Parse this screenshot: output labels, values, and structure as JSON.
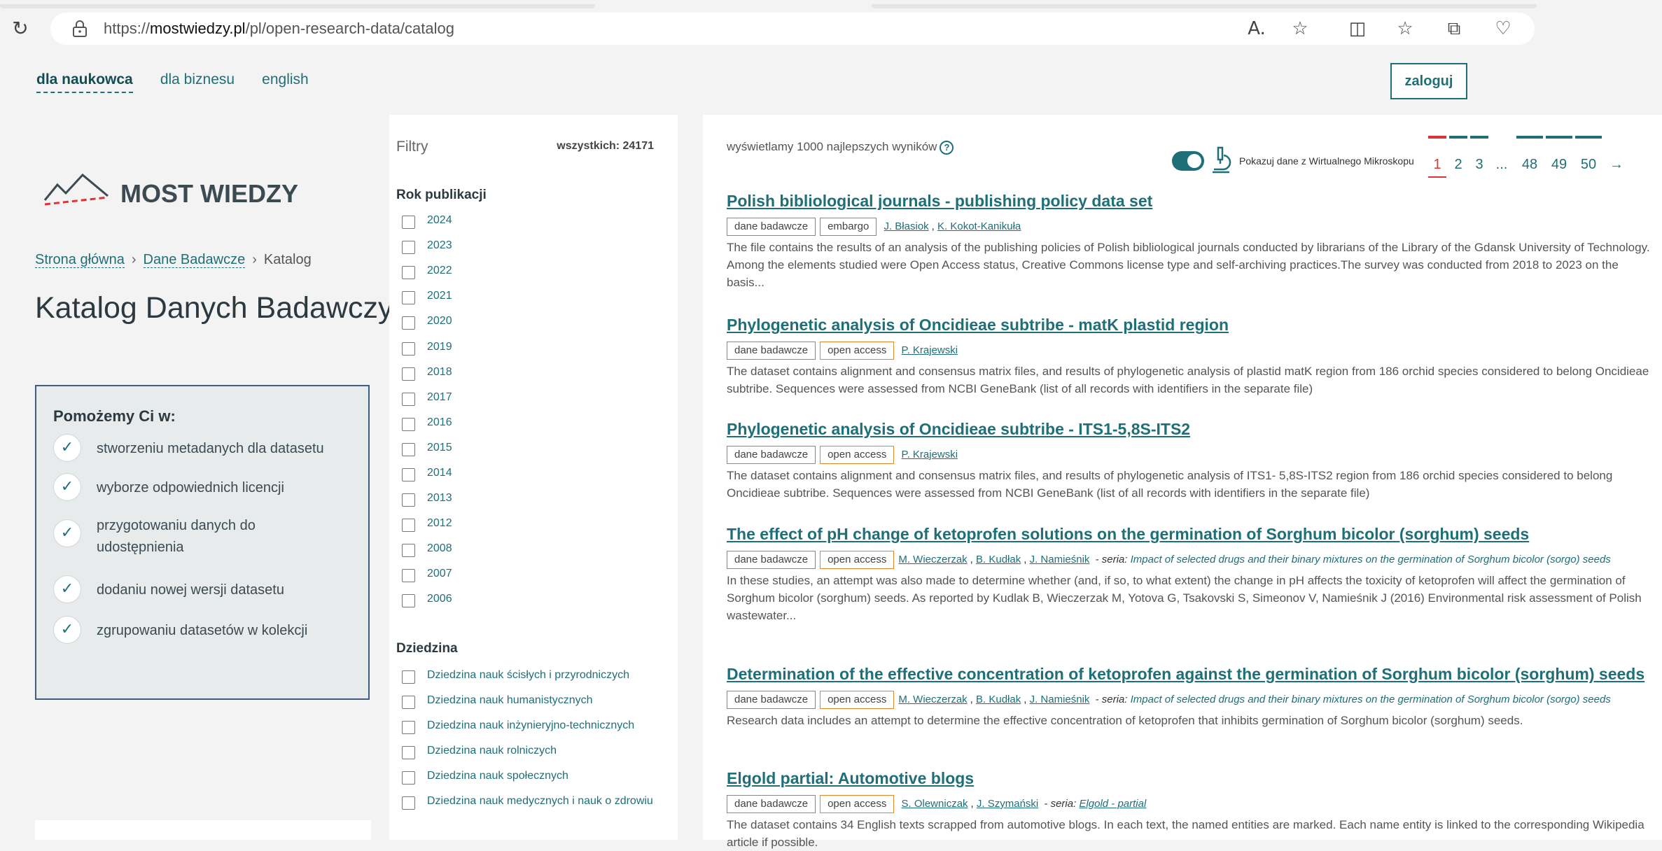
{
  "browser": {
    "url_prefix": "https://",
    "url_domain": "mostwiedzy.pl",
    "url_path": "/pl/open-research-data/catalog"
  },
  "header": {
    "nav": [
      "dla naukowca",
      "dla biznesu",
      "english"
    ],
    "login_label": "zaloguj"
  },
  "logo": {
    "text": "MOST WIEDZY"
  },
  "breadcrumb": {
    "home": "Strona główna",
    "section": "Dane Badawcze",
    "current": "Katalog"
  },
  "page_title": "Katalog Danych Badawczych",
  "help_box": {
    "title": "Pomożemy Ci w:",
    "items": [
      "stworzeniu metadanych dla datasetu",
      "wyborze odpowiednich licencji",
      "przygotowaniu danych do udostępnienia",
      "dodaniu nowej wersji datasetu",
      "zgrupowaniu datasetów w kolekcji"
    ]
  },
  "filters": {
    "title": "Filtry",
    "total": "wszystkich: 24171",
    "year_title": "Rok publikacji",
    "years": [
      "2024",
      "2023",
      "2022",
      "2021",
      "2020",
      "2019",
      "2018",
      "2017",
      "2016",
      "2015",
      "2014",
      "2013",
      "2012",
      "2008",
      "2007",
      "2006"
    ],
    "field_title": "Dziedzina",
    "fields": [
      "Dziedzina nauk ścisłych i przyrodniczych",
      "Dziedzina nauk humanistycznych",
      "Dziedzina nauk inżynieryjno-technicznych",
      "Dziedzina nauk rolniczych",
      "Dziedzina nauk społecznych",
      "Dziedzina nauk medycznych i nauk o zdrowiu"
    ]
  },
  "results_header": {
    "info": "wyświetlamy 1000 najlepszych wyników",
    "help_glyph": "?",
    "microscope_label": "Pokazuj dane z Wirtualnego Mikroskopu",
    "microscope_on": true,
    "pages": [
      "1",
      "2",
      "3",
      "...",
      "48",
      "49",
      "50",
      "→"
    ],
    "current_page": "1"
  },
  "tags": {
    "dataset": "dane badawcze",
    "open": "open access",
    "embargo": "embargo"
  },
  "series_label": " - seria: ",
  "results": [
    {
      "title": "Polish bibliological journals - publishing policy data set",
      "access": "embargo",
      "authors": [
        "J. Błasiok",
        "K. Kokot-Kanikuła"
      ],
      "series": "",
      "description": "The file contains the results of an analysis of the publishing policies of Polish bibliological journals conducted by librarians of the Library of the Gdansk University of Technology. Among the elements studied were Open Access status, Creative Commons license type and self-archiving practices.The survey was conducted from 2018 to 2023 on the basis..."
    },
    {
      "title": "Phylogenetic analysis of Oncidieae subtribe - matK plastid region",
      "access": "open access",
      "authors": [
        "P. Krajewski"
      ],
      "series": "",
      "description": "The dataset contains alignment and consensus matrix files, and results of phylogenetic analysis of plastid matK region from 186 orchid species considered to belong Oncidieae subtribe. Sequences were assessed from NCBI GeneBank (list of all records with identifiers in the separate file)"
    },
    {
      "title": "Phylogenetic analysis of Oncidieae subtribe - ITS1-5,8S-ITS2",
      "access": "open access",
      "authors": [
        "P. Krajewski"
      ],
      "series": "",
      "description": "The dataset contains alignment and consensus matrix files, and results of phylogenetic analysis of ITS1- 5,8S-ITS2 region from 186 orchid species considered to belong Oncidieae subtribe. Sequences were assessed from NCBI GeneBank (list of all records with identifiers in the separate file)"
    },
    {
      "title": "The effect of pH change of ketoprofen solutions on the germination of Sorghum bicolor (sorghum) seeds",
      "access": "open access",
      "authors": [
        "M. Wieczerzak",
        "B. Kudłak",
        "J. Namieśnik"
      ],
      "series": "Impact of selected drugs and their binary mixtures on the germination of Sorghum bicolor (sorgo) seeds",
      "description": "In these studies, an attempt was also made to determine whether (and, if so, to what extent) the change in pH affects the toxicity of ketoprofen will affect the germination of Sorghum bicolor (sorghum) seeds. As reported by Kudlak B, Wieczerzak M, Yotova G, Tsakovski S, Simeonov V, Namieśnik J (2016) Environmental risk assessment of Polish wastewater..."
    },
    {
      "title": "Determination of the effective concentration of ketoprofen against the germination of Sorghum bicolor (sorghum) seeds",
      "access": "open access",
      "authors": [
        "M. Wieczerzak",
        "B. Kudłak",
        "J. Namieśnik"
      ],
      "series": "Impact of selected drugs and their binary mixtures on the germination of Sorghum bicolor (sorgo) seeds",
      "description": "Research data includes an attempt to determine the effective concentration of ketoprofen that inhibits germination of Sorghum bicolor (sorghum) seeds."
    },
    {
      "title": "Elgold partial: Automotive blogs",
      "access": "open access",
      "authors": [
        "S. Olewniczak",
        "J. Szymański"
      ],
      "series": "Elgold - partial",
      "description": "The dataset contains 34 English texts scrapped from automotive blogs. In each text, the named entities are marked. Each name entity is linked to the corresponding Wikipedia article if possible."
    }
  ],
  "colors": {
    "accent": "#1f6f78",
    "active_page": "#dd3333",
    "open_access_border": "#e28a2b",
    "help_box_border": "#3d5d80"
  }
}
